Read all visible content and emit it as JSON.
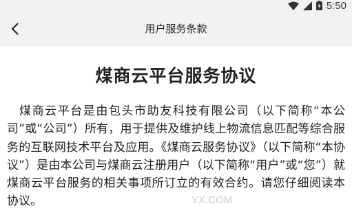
{
  "status_bar": {
    "time": "5:50",
    "icons": [
      "wifi-icon",
      "cellular-signal-icon",
      "battery-icon"
    ]
  },
  "app_bar": {
    "back_icon": "chevron-left-icon",
    "title": "用户服务条款"
  },
  "document": {
    "title": "煤商云平台服务协议",
    "body": "煤商云平台是由包头市助友科技有限公司（以下简称“本公司”或“公司”）所有，用于提供及维护线上物流信息匹配等综合服务的互联网技术平台及应用。《煤商云服务协议》（以下简称“本协议”）是由本公司与煤商云注册用户（以下简称“用户”或“您”）就煤商云平台服务的相关事项所订立的有效合约。请您仔细阅读本协议。"
  },
  "watermark": {
    "text": "YX.COM"
  },
  "colors": {
    "bar_background": "#f2f2f2",
    "text": "#222222",
    "watermark": "#c9c4dc"
  }
}
